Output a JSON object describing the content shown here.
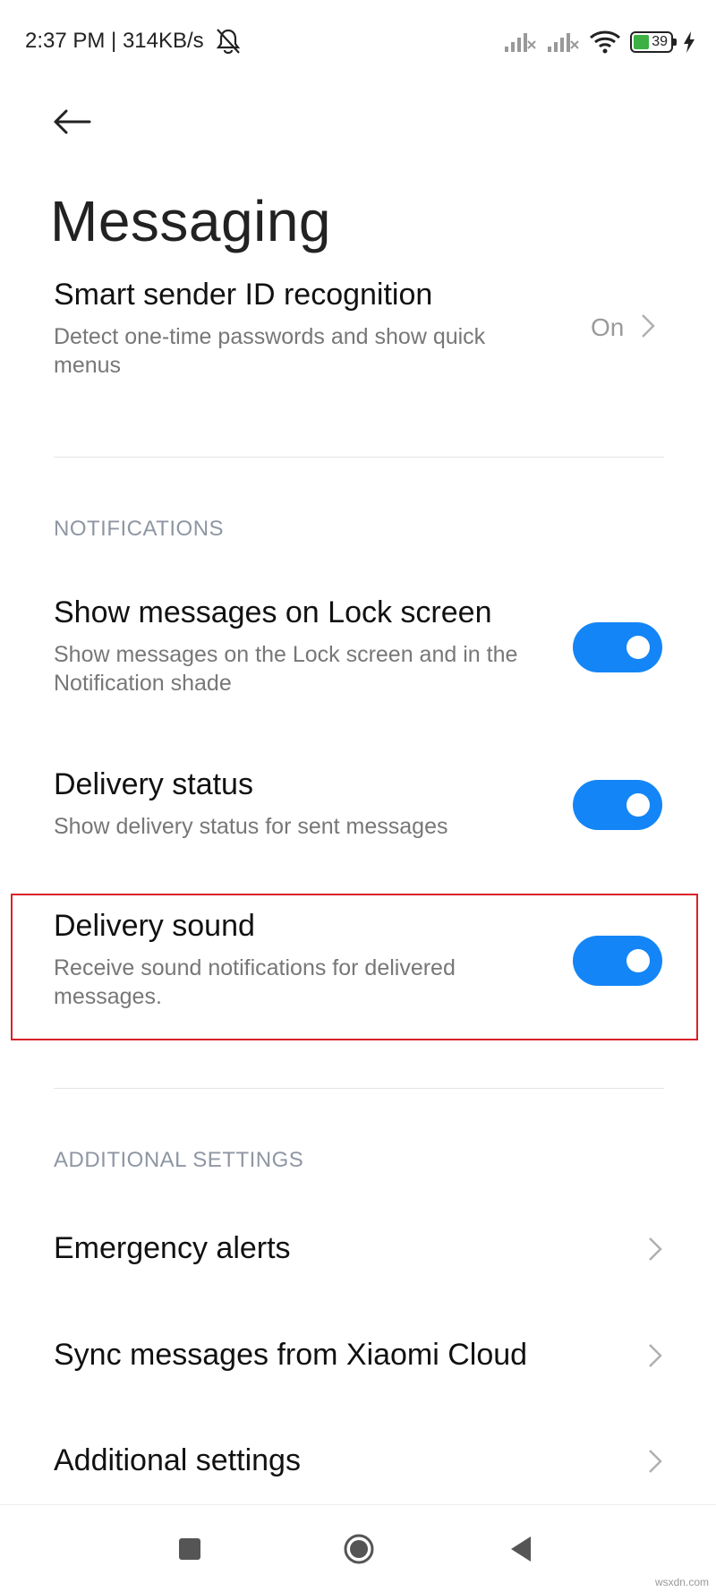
{
  "status_bar": {
    "time_speed": "2:37 PM | 314KB/s",
    "battery_level": "39"
  },
  "header": {
    "title": "Messaging"
  },
  "items": {
    "smart_sender": {
      "title": "Smart sender ID recognition",
      "subtitle": "Detect one-time passwords and show quick menus",
      "value": "On"
    },
    "notifications_header": "NOTIFICATIONS",
    "lock_screen": {
      "title": "Show messages on Lock screen",
      "subtitle": "Show messages on the Lock screen and in the Notification shade",
      "enabled": true
    },
    "delivery_status": {
      "title": "Delivery status",
      "subtitle": "Show delivery status for sent messages",
      "enabled": true
    },
    "delivery_sound": {
      "title": "Delivery sound",
      "subtitle": "Receive sound notifications for delivered messages.",
      "enabled": true
    },
    "additional_header": "ADDITIONAL SETTINGS",
    "emergency_alerts": {
      "title": "Emergency alerts"
    },
    "sync_cloud": {
      "title": "Sync messages from Xiaomi Cloud"
    },
    "additional_settings": {
      "title": "Additional settings"
    }
  },
  "watermark": "wsxdn.com",
  "colors": {
    "accent": "#1485f6",
    "highlight": "#d9222a",
    "section_header": "#8f96a3"
  }
}
